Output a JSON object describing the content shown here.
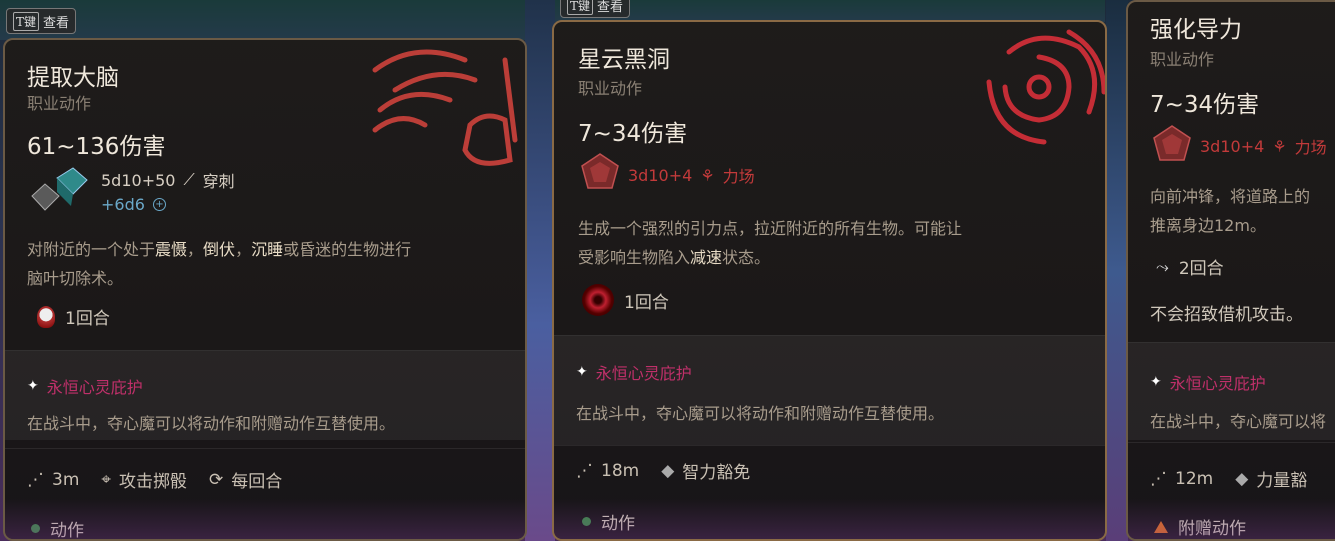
{
  "colors": {
    "accent_red": "#c23a3a",
    "passive_pink": "#c0306a",
    "action_green": "#3d8a4a",
    "bonus_orange": "#e07020"
  },
  "tkey": {
    "key": "T键",
    "label": "查看"
  },
  "cards": [
    {
      "title": "提取大脑",
      "subtitle": "职业动作",
      "damage": "61~136伤害",
      "dice": "5d10+50",
      "damage_type": "穿刺",
      "extra": "+6d6",
      "desc_parts": [
        "对附近的一个处于",
        "震慑",
        "，",
        "倒伏",
        "，",
        "沉睡",
        "或昏迷的生物进行",
        "脑叶切除术。"
      ],
      "duration": "1回合",
      "passive_title": "永恒心灵庇护",
      "passive_desc": "在战斗中，夺心魔可以将动作和附赠动作互替使用。",
      "range": "3m",
      "roll": "攻击掷骰",
      "recharge": "每回合",
      "type": "动作"
    },
    {
      "title": "星云黑洞",
      "subtitle": "职业动作",
      "damage": "7~34伤害",
      "dice": "3d10+4",
      "damage_type": "力场",
      "desc_parts": [
        "生成一个强烈的引力点，拉近附近的所有生物。可能让",
        "受影响生物陷入",
        "减速",
        "状态。"
      ],
      "duration": "1回合",
      "passive_title": "永恒心灵庇护",
      "passive_desc": "在战斗中，夺心魔可以将动作和附赠动作互替使用。",
      "range": "18m",
      "save": "智力豁免",
      "type": "动作"
    },
    {
      "title": "强化导力",
      "subtitle": "职业动作",
      "damage": "7~34伤害",
      "dice": "3d10+4",
      "damage_type": "力场",
      "desc_parts": [
        "向前冲锋，将道路上的",
        "推离身边12m。"
      ],
      "duration": "2回合",
      "note": "不会招致借机攻击。",
      "passive_title": "永恒心灵庇护",
      "passive_desc": "在战斗中，夺心魔可以将",
      "range": "12m",
      "save": "力量豁",
      "type": "附赠动作"
    }
  ]
}
